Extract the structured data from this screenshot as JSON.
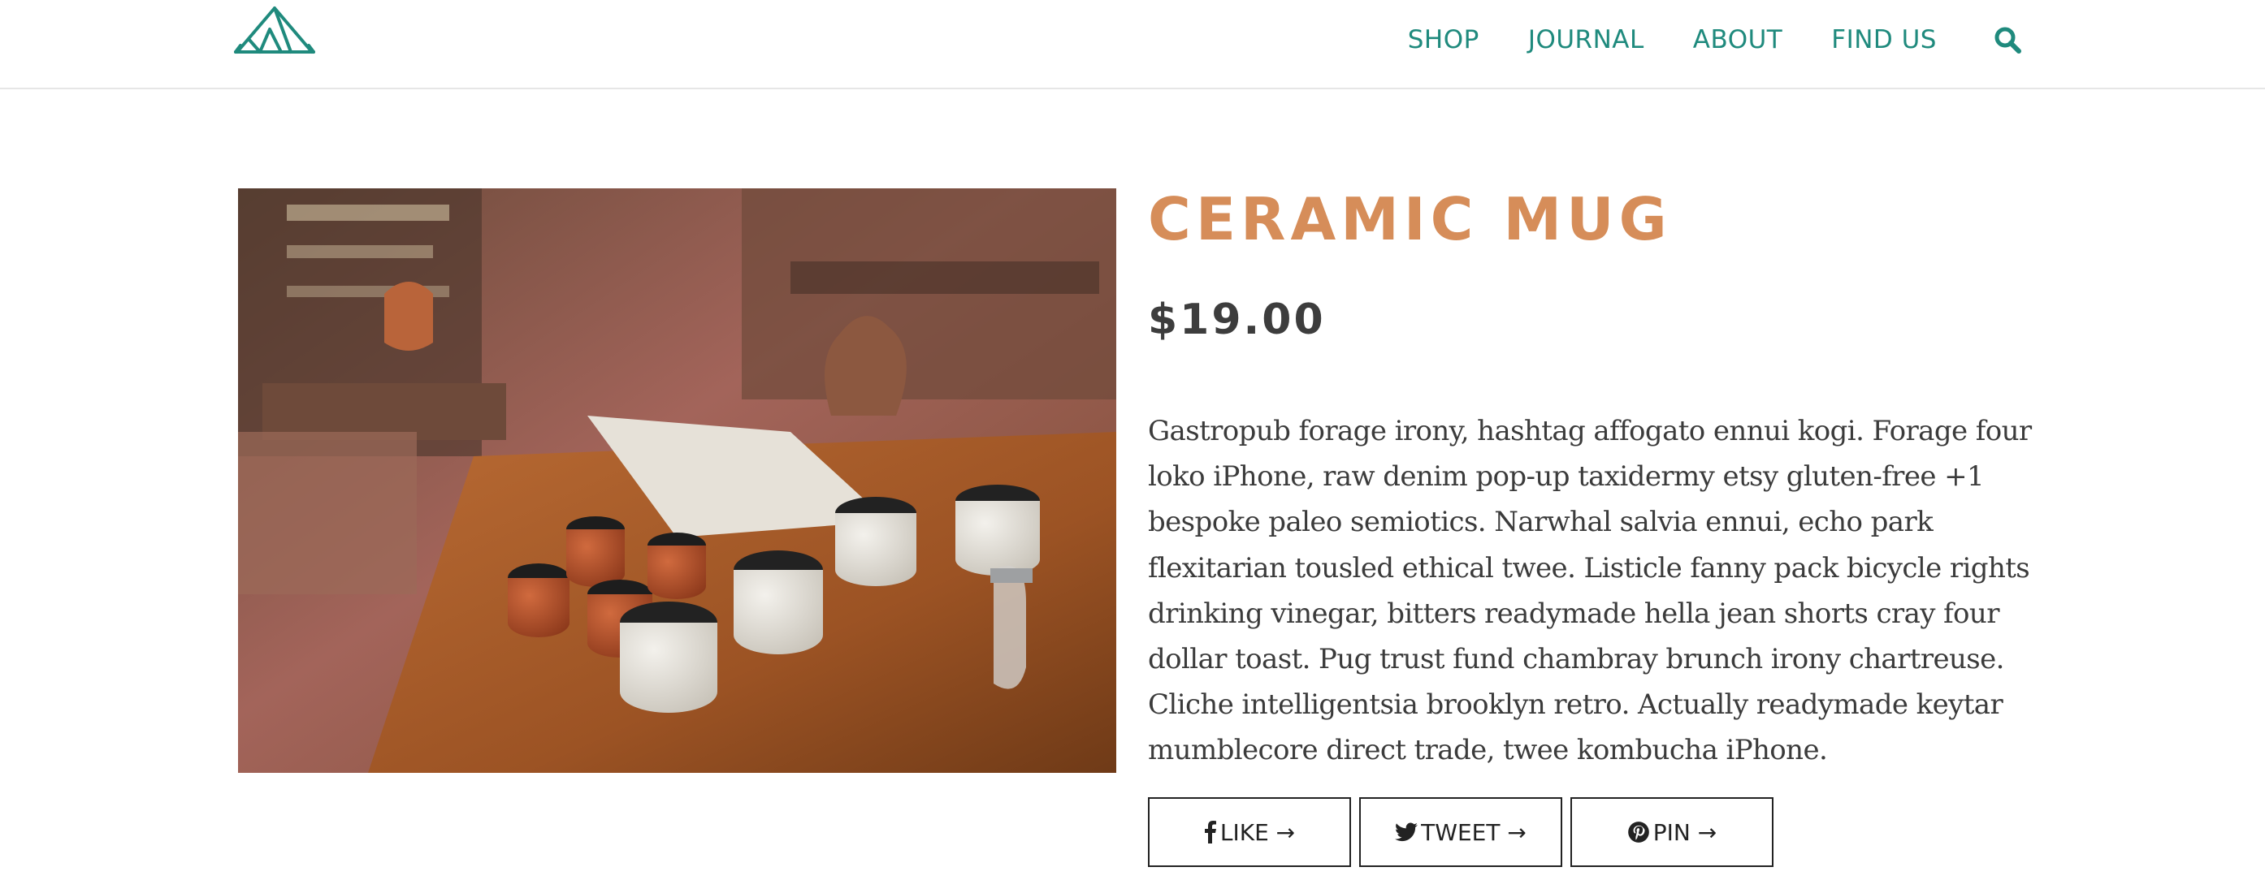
{
  "nav": {
    "items": [
      {
        "label": "SHOP"
      },
      {
        "label": "JOURNAL"
      },
      {
        "label": "ABOUT"
      },
      {
        "label": "FIND US"
      }
    ],
    "search_icon": "search-icon"
  },
  "product": {
    "title": "CERAMIC MUG",
    "price": "$19.00",
    "description": "Gastropub forage irony, hashtag affogato ennui kogi. Forage four loko iPhone, raw denim pop-up taxidermy etsy gluten-free +1 bespoke paleo semiotics. Narwhal salvia ennui, echo park flexitarian tousled ethical twee. Listicle fanny pack bicycle rights drinking vinegar, bitters readymade hella jean shorts cray four dollar toast. Pug trust fund chambray brunch irony chartreuse. Cliche intelligentsia brooklyn retro. Actually readymade keytar mumblecore direct trade, twee kombucha iPhone."
  },
  "share": {
    "like": "LIKE →",
    "tweet": "TWEET →",
    "pin": "PIN →"
  },
  "colors": {
    "accent": "#1f8a7d",
    "title": "#d68d59",
    "text": "#3b3b3b"
  }
}
